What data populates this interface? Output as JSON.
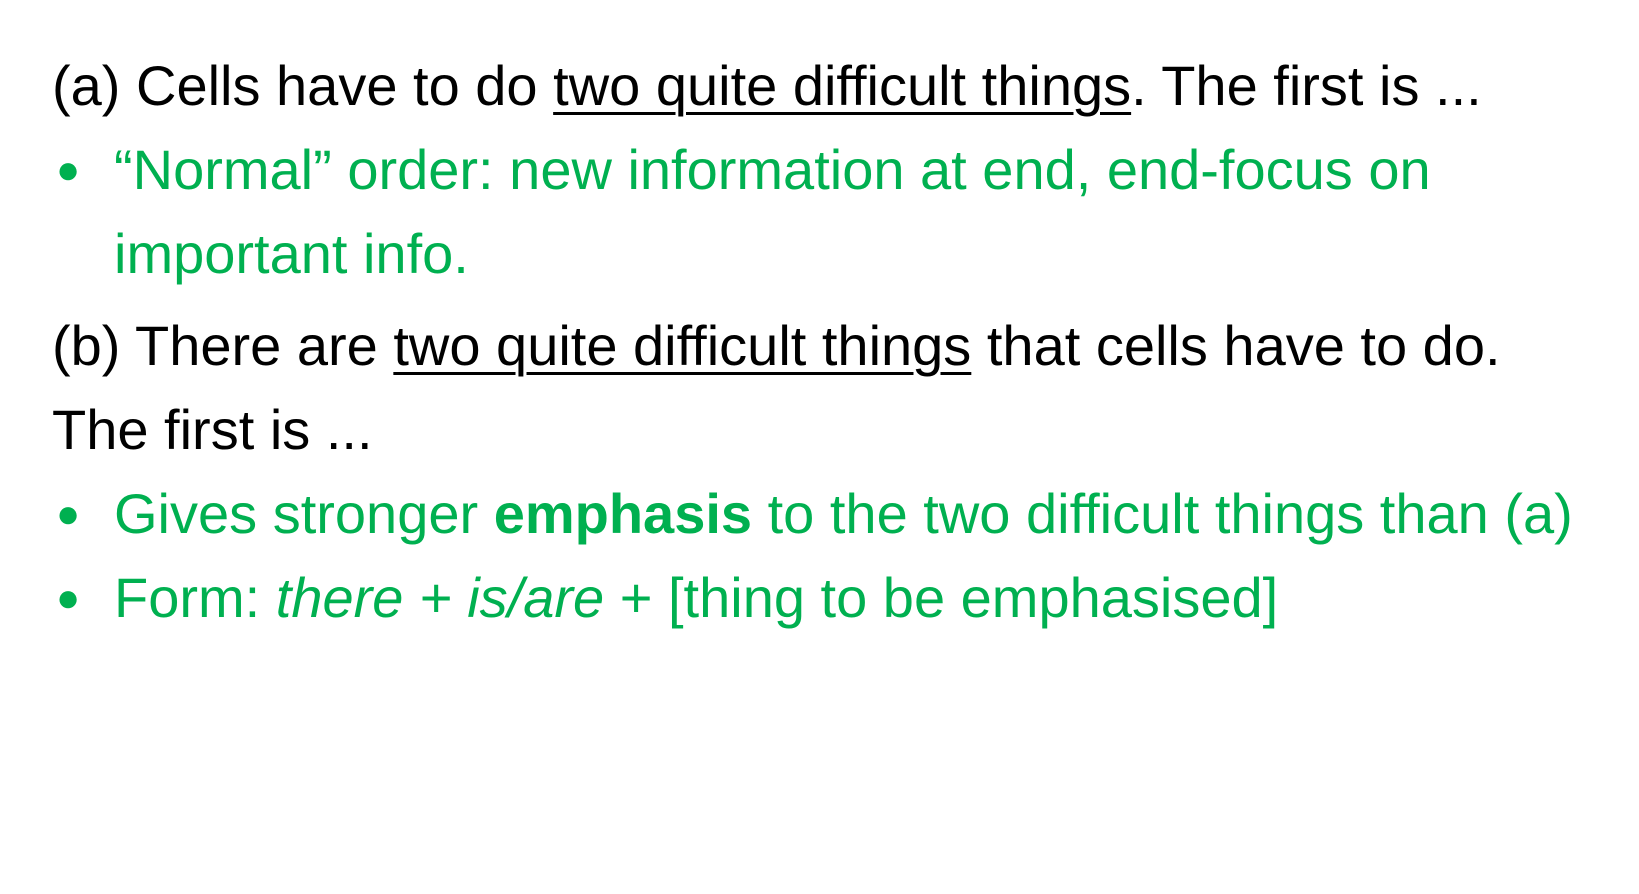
{
  "colors": {
    "text": "#000000",
    "accent_green": "#00b050",
    "background": "#ffffff"
  },
  "para_a": {
    "prefix": "(a) Cells have to do ",
    "underlined": "two quite difficult things",
    "suffix": ". The first is ..."
  },
  "bullets_a": [
    {
      "text": "“Normal” order: new information at end, end-focus on important info."
    }
  ],
  "para_b": {
    "prefix": "(b) There are ",
    "underlined": "two quite difficult things",
    "suffix": " that cells have to do. The first is ..."
  },
  "bullets_b": [
    {
      "pre": "Gives stronger ",
      "bold": "emphasis",
      "post": " to the two difficult things than (a)"
    },
    {
      "pre": "Form: ",
      "italic": "there + is/are",
      "post": " + [thing to be emphasised]"
    }
  ],
  "icons": {
    "bullet": "bullet-dot-icon"
  }
}
